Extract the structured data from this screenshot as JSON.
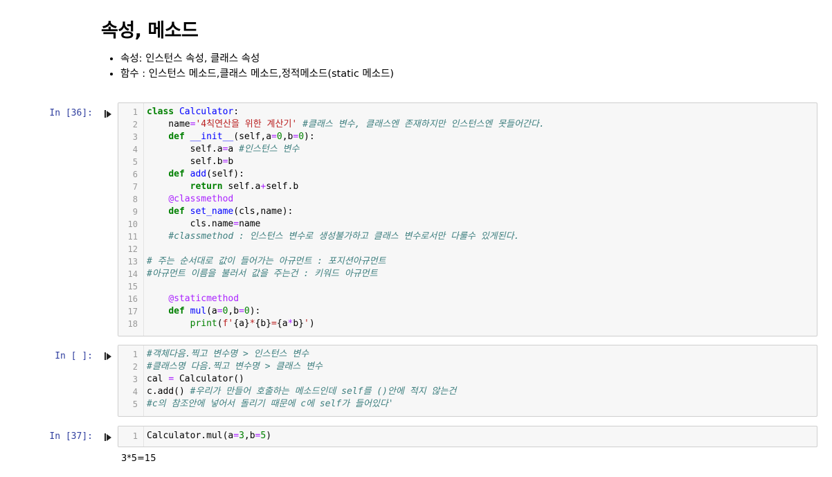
{
  "markdown": {
    "title": "속성, 메소드",
    "bullets": [
      "속성: 인스턴스 속성, 클래스 속성",
      "함수 : 인스턴스 메소드,클래스 메소드,정적메소드(static 메소드)"
    ]
  },
  "cells": [
    {
      "prompt": "In [36]:",
      "lines": [
        {
          "n": "1",
          "tokens": [
            [
              "kw",
              "class"
            ],
            [
              "",
              ""
            ],
            [
              "",
              " "
            ],
            [
              "cls",
              "Calculator"
            ],
            [
              "",
              ":"
            ]
          ]
        },
        {
          "n": "2",
          "tokens": [
            [
              "",
              "    name"
            ],
            [
              "op",
              "="
            ],
            [
              "str",
              "'4칙연산을 위한 계산기'"
            ],
            [
              "",
              " "
            ],
            [
              "cm",
              "#클래스 변수, 클래스엔 존재하지만 인스턴스엔 못들어간다."
            ]
          ]
        },
        {
          "n": "3",
          "tokens": [
            [
              "",
              "    "
            ],
            [
              "kw",
              "def"
            ],
            [
              "",
              " "
            ],
            [
              "fn",
              "__init__"
            ],
            [
              "",
              "(self,a"
            ],
            [
              "op",
              "="
            ],
            [
              "num",
              "0"
            ],
            [
              "",
              ",b"
            ],
            [
              "op",
              "="
            ],
            [
              "num",
              "0"
            ],
            [
              "",
              "):"
            ]
          ]
        },
        {
          "n": "4",
          "tokens": [
            [
              "",
              "        self.a"
            ],
            [
              "op",
              "="
            ],
            [
              "",
              "a "
            ],
            [
              "cm",
              "#인스턴스 변수"
            ]
          ]
        },
        {
          "n": "5",
          "tokens": [
            [
              "",
              "        self.b"
            ],
            [
              "op",
              "="
            ],
            [
              "",
              "b"
            ]
          ]
        },
        {
          "n": "6",
          "tokens": [
            [
              "",
              "    "
            ],
            [
              "kw",
              "def"
            ],
            [
              "",
              " "
            ],
            [
              "fn",
              "add"
            ],
            [
              "",
              "(self):"
            ]
          ]
        },
        {
          "n": "7",
          "tokens": [
            [
              "",
              "        "
            ],
            [
              "kw",
              "return"
            ],
            [
              "",
              " self.a"
            ],
            [
              "op",
              "+"
            ],
            [
              "",
              "self.b"
            ]
          ]
        },
        {
          "n": "8",
          "tokens": [
            [
              "",
              "    "
            ],
            [
              "dec",
              "@classmethod"
            ]
          ]
        },
        {
          "n": "9",
          "tokens": [
            [
              "",
              "    "
            ],
            [
              "kw",
              "def"
            ],
            [
              "",
              " "
            ],
            [
              "fn",
              "set_name"
            ],
            [
              "",
              "(cls,name):"
            ]
          ]
        },
        {
          "n": "10",
          "tokens": [
            [
              "",
              "        cls.name"
            ],
            [
              "op",
              "="
            ],
            [
              "",
              "name"
            ]
          ]
        },
        {
          "n": "11",
          "tokens": [
            [
              "",
              "    "
            ],
            [
              "cm",
              "#classmethod : 인스턴스 변수로 생성불가하고 클래스 변수로서만 다룰수 있게된다."
            ]
          ]
        },
        {
          "n": "12",
          "tokens": [
            [
              "",
              ""
            ]
          ]
        },
        {
          "n": "13",
          "tokens": [
            [
              "cm",
              "# 주는 순서대로 값이 들어가는 아규먼트 : 포지션아규먼트"
            ]
          ]
        },
        {
          "n": "14",
          "tokens": [
            [
              "cm",
              "#아규먼트 이름을 불러서 값을 주는건 : 키워드 아규먼트"
            ]
          ]
        },
        {
          "n": "15",
          "tokens": [
            [
              "",
              ""
            ]
          ]
        },
        {
          "n": "16",
          "tokens": [
            [
              "",
              "    "
            ],
            [
              "dec",
              "@staticmethod"
            ]
          ]
        },
        {
          "n": "17",
          "tokens": [
            [
              "",
              "    "
            ],
            [
              "kw",
              "def"
            ],
            [
              "",
              " "
            ],
            [
              "fn",
              "mul"
            ],
            [
              "",
              "(a"
            ],
            [
              "op",
              "="
            ],
            [
              "num",
              "0"
            ],
            [
              "",
              ",b"
            ],
            [
              "op",
              "="
            ],
            [
              "num",
              "0"
            ],
            [
              "",
              "):"
            ]
          ]
        },
        {
          "n": "18",
          "tokens": [
            [
              "",
              "        "
            ],
            [
              "bi",
              "print"
            ],
            [
              "",
              "("
            ],
            [
              "str",
              "f'"
            ],
            [
              "",
              "{a}"
            ],
            [
              "str",
              "*"
            ],
            [
              "",
              "{b}"
            ],
            [
              "str",
              "="
            ],
            [
              "",
              "{a"
            ],
            [
              "op",
              "*"
            ],
            [
              "",
              "b}"
            ],
            [
              "str",
              "'"
            ],
            [
              "",
              ")"
            ]
          ]
        }
      ]
    },
    {
      "prompt": "In [ ]:",
      "lines": [
        {
          "n": "1",
          "tokens": [
            [
              "cm",
              "#객체다음.찍고 변수명 > 인스턴스 변수"
            ]
          ]
        },
        {
          "n": "2",
          "tokens": [
            [
              "cm",
              "#클래스명 다음.찍고 변수명 > 클래스 변수"
            ]
          ]
        },
        {
          "n": "3",
          "tokens": [
            [
              "",
              "cal "
            ],
            [
              "op",
              "="
            ],
            [
              "",
              " Calculator()"
            ]
          ]
        },
        {
          "n": "4",
          "tokens": [
            [
              "",
              "c.add() "
            ],
            [
              "cm",
              "#우리가 만들어 호출하는 메소드인데 self를 ()안에 적지 않는건"
            ]
          ]
        },
        {
          "n": "5",
          "tokens": [
            [
              "cm",
              "#c의 참조안에 넣어서 돌리기 때문에 c에 self가 들어있다'"
            ]
          ]
        }
      ]
    },
    {
      "prompt": "In [37]:",
      "lines": [
        {
          "n": "1",
          "tokens": [
            [
              "",
              "Calculator.mul(a"
            ],
            [
              "op",
              "="
            ],
            [
              "num",
              "3"
            ],
            [
              "",
              ",b"
            ],
            [
              "op",
              "="
            ],
            [
              "num",
              "5"
            ],
            [
              "",
              ")"
            ]
          ]
        }
      ],
      "output": "3*5=15"
    }
  ]
}
